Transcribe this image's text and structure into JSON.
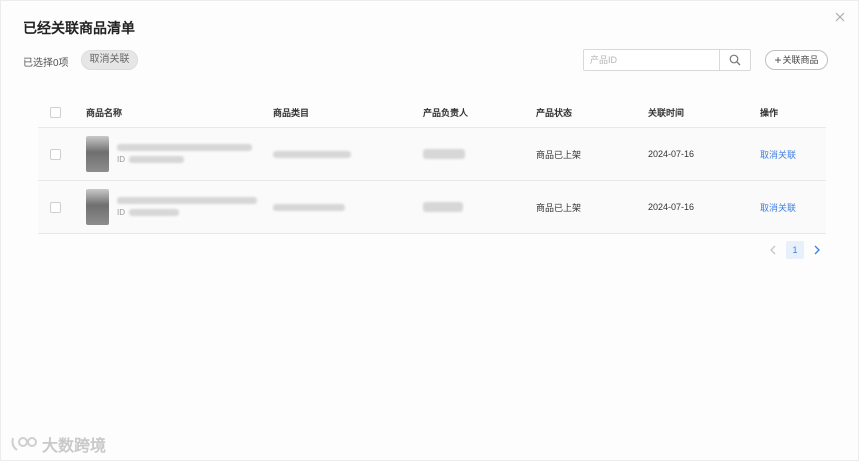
{
  "dialog": {
    "title": "已经关联商品清单",
    "selected_count": "已选择0项",
    "unlink_all_label": "取消关联",
    "search": {
      "placeholder": "产品ID",
      "value": ""
    },
    "add_label": "关联商品"
  },
  "table": {
    "columns": [
      "商品名称",
      "商品类目",
      "产品负责人",
      "产品状态",
      "关联时间",
      "操作"
    ],
    "rows": [
      {
        "id_prefix": "ID",
        "status": "商品已上架",
        "time": "2024-07-16",
        "action": "取消关联"
      },
      {
        "id_prefix": "ID",
        "status": "商品已上架",
        "time": "2024-07-16",
        "action": "取消关联"
      }
    ]
  },
  "pagination": {
    "current": "1"
  },
  "watermark": {
    "text": "大数跨境"
  },
  "colors": {
    "link": "#3d7fe0",
    "accent_bg": "#e8f0fb"
  },
  "icons": [
    "close-icon",
    "search-icon",
    "plus-icon",
    "chevron-left-icon",
    "chevron-right-icon",
    "watermark-logo-icon"
  ]
}
